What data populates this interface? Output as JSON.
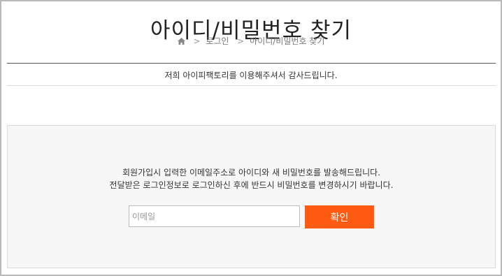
{
  "page": {
    "title": "아이디/비밀번호 찾기",
    "breadcrumb": {
      "home_icon": "home-icon",
      "separator": ">",
      "items": [
        "로그인",
        "아이디/비밀번호 찾기"
      ]
    },
    "thanks_message": "저희 아이피팩토리를 이용해주셔서 감사드립니다."
  },
  "find_form": {
    "notice_lines": [
      "회원가입시 입력한 이메일주소로 아이디와 새 비밀번호를 발송해드립니다.",
      "전달받은 로그인정보로 로그인하신 후에 반드시 비밀번호를 변경하시기 바랍니다."
    ],
    "email": {
      "placeholder": "이메일",
      "value": ""
    },
    "confirm_label": "확인"
  },
  "colors": {
    "accent": "#ff5a12",
    "panel_bg": "#f7f7f7",
    "frame_border": "#b9b9b9"
  }
}
